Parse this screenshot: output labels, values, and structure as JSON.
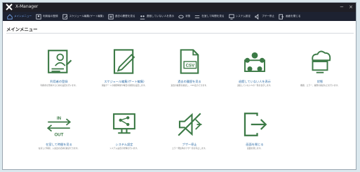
{
  "window": {
    "title": "X-Manager"
  },
  "toolbar": {
    "items": [
      {
        "label": "メインメニュー",
        "icon": "home-icon"
      },
      {
        "label": "利用者の登録",
        "icon": "user-register-icon"
      },
      {
        "label": "スケジュール編集(ゲート編集)",
        "icon": "schedule-edit-icon"
      },
      {
        "label": "過去の履歴を見る",
        "icon": "history-icon"
      },
      {
        "label": "退館していない人を表示",
        "icon": "people-icon"
      },
      {
        "label": "状態",
        "icon": "cloud-status-icon"
      },
      {
        "label": "在室して時間を見る",
        "icon": "in-out-icon"
      },
      {
        "label": "システム設定",
        "icon": "system-settings-icon"
      },
      {
        "label": "ブザー停止",
        "icon": "buzzer-stop-icon"
      },
      {
        "label": "画面を閉じる",
        "icon": "exit-icon"
      }
    ]
  },
  "main": {
    "section_title": "メインメニュー",
    "cards": [
      {
        "label": "利用者の登録",
        "desc": "利用者を登録するための設定を行います。",
        "icon": "user-register-icon"
      },
      {
        "label": "スケジュール編集(ゲート編集)",
        "desc": "開錠ゲートの開閉時間や曜日の開閉を設定します。",
        "icon": "schedule-edit-icon"
      },
      {
        "label": "過去の履歴を見る",
        "desc": "過去の履歴を確認し、CSV出力できます。",
        "icon": "csv-history-icon"
      },
      {
        "label": "退館していない人を表示",
        "desc": "退館していない人の一覧を表示します。",
        "icon": "people-icon"
      },
      {
        "label": "状態",
        "desc": "機器、エラー、履歴の確認などを行います。",
        "icon": "cloud-status-icon"
      },
      {
        "label": "在室して時間を見る",
        "desc": "在室した時間、入退出の記録を確認できます。",
        "icon": "in-out-icon"
      },
      {
        "label": "システム設定",
        "desc": "システム設定の管理を行います。",
        "icon": "system-settings-icon"
      },
      {
        "label": "ブザー停止",
        "desc": "エラー発生時のブザー音を停止します。",
        "icon": "buzzer-stop-icon"
      },
      {
        "label": "画面を閉じる",
        "desc": "画面を閉じます。",
        "icon": "exit-icon"
      }
    ]
  },
  "colors": {
    "accent": "#2f6da7",
    "toolbar_bg": "#1d2231",
    "icon_green": "#3c7a46"
  }
}
